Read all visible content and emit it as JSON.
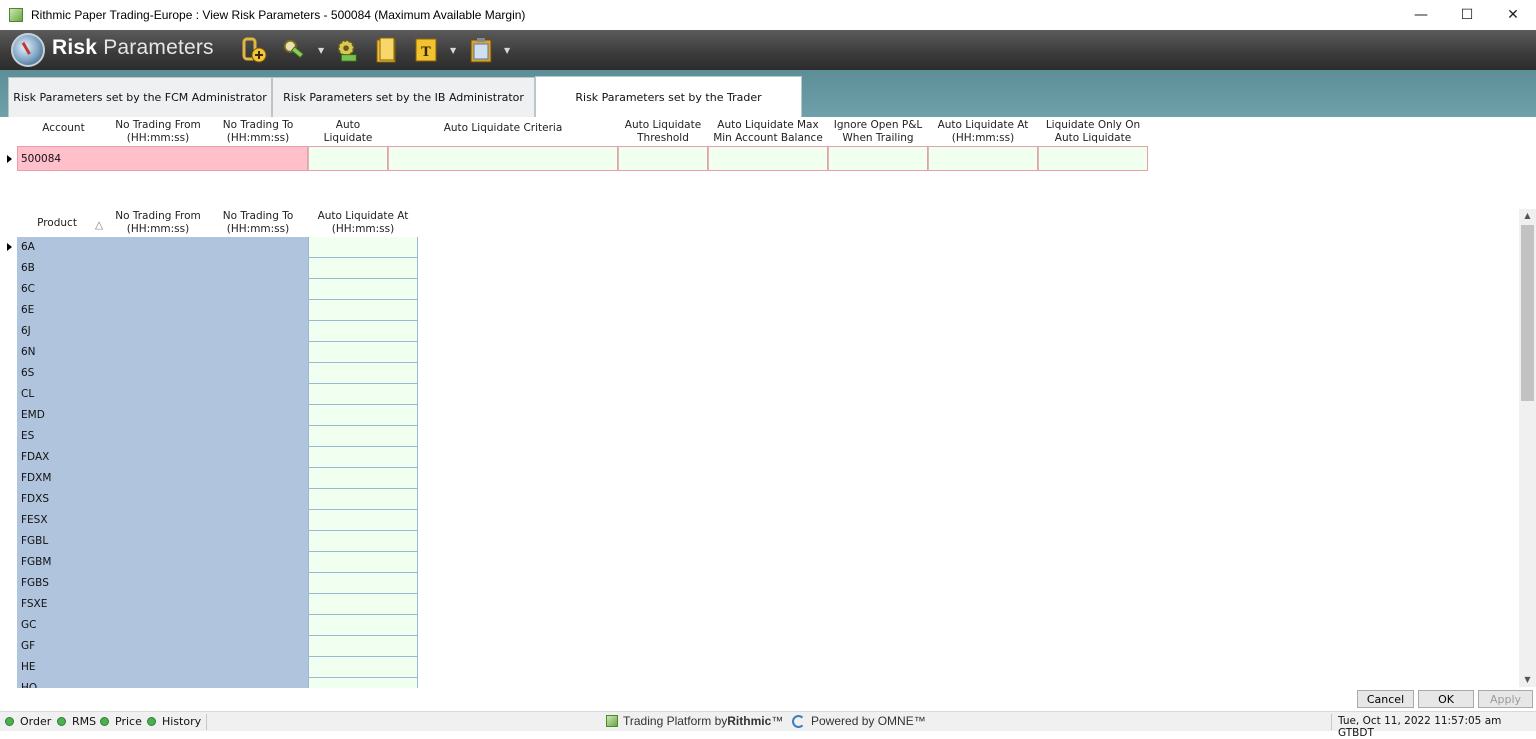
{
  "window": {
    "title": "Rithmic Paper Trading-Europe : View Risk Parameters - 500084 (Maximum Available Margin)",
    "minimize": "—",
    "maximize": "☐",
    "close": "✕"
  },
  "toolbar": {
    "logo_bold": "Risk",
    "logo_thin": "Parameters",
    "icons": [
      "add-account-icon",
      "settings-tools-icon",
      "gear-money-icon",
      "folder-icon",
      "text-template-icon",
      "clipboard-icon"
    ]
  },
  "tabs": [
    {
      "label": "Risk Parameters set by the FCM Administrator",
      "active": false
    },
    {
      "label": "Risk Parameters set by the IB Administrator",
      "active": false
    },
    {
      "label": "Risk Parameters set by the Trader",
      "active": true
    }
  ],
  "account_grid": {
    "headers": [
      {
        "line1": "",
        "line2": "Account"
      },
      {
        "line1": "No Trading From",
        "line2": "(HH:mm:ss)"
      },
      {
        "line1": "No Trading To",
        "line2": "(HH:mm:ss)"
      },
      {
        "line1": "Auto",
        "line2": "Liquidate"
      },
      {
        "line1": "",
        "line2": "Auto Liquidate Criteria"
      },
      {
        "line1": "Auto Liquidate",
        "line2": "Threshold"
      },
      {
        "line1": "Auto Liquidate Max",
        "line2": "Min Account Balance"
      },
      {
        "line1": "Ignore Open P&L",
        "line2": "When Trailing"
      },
      {
        "line1": "Auto Liquidate At",
        "line2": "(HH:mm:ss)"
      },
      {
        "line1": "Liquidate Only On",
        "line2": "Auto Liquidate"
      }
    ],
    "rows": [
      {
        "account": "500084"
      }
    ]
  },
  "product_grid": {
    "headers": [
      {
        "line1": "",
        "line2": "Product",
        "sort": "△"
      },
      {
        "line1": "No Trading From",
        "line2": "(HH:mm:ss)"
      },
      {
        "line1": "No Trading To",
        "line2": "(HH:mm:ss)"
      },
      {
        "line1": "Auto Liquidate At",
        "line2": "(HH:mm:ss)"
      }
    ],
    "rows": [
      "6A",
      "6B",
      "6C",
      "6E",
      "6J",
      "6N",
      "6S",
      "CL",
      "EMD",
      "ES",
      "FDAX",
      "FDXM",
      "FDXS",
      "FESX",
      "FGBL",
      "FGBM",
      "FGBS",
      "FSXE",
      "GC",
      "GF",
      "HE",
      "HO"
    ]
  },
  "buttons": {
    "cancel": "Cancel",
    "ok": "OK",
    "apply": "Apply"
  },
  "status": {
    "items": [
      "Order",
      "RMS",
      "Price",
      "History"
    ],
    "brand_prefix": "Trading Platform by ",
    "brand_name": "Rithmic",
    "brand_tm": "™",
    "powered": "Powered by OMNE™",
    "datetime": "Tue, Oct 11, 2022 11:57:05 am GTBDT"
  }
}
